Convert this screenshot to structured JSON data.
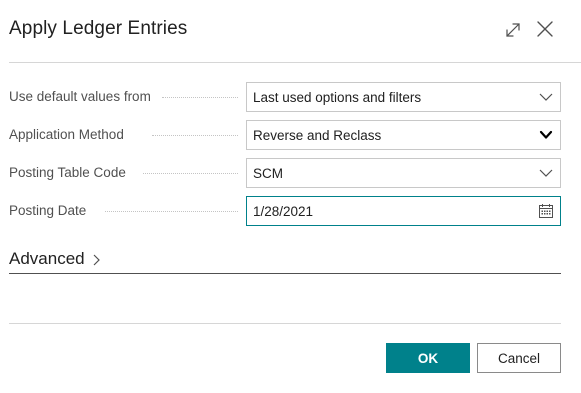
{
  "dialog": {
    "title": "Apply Ledger Entries"
  },
  "fields": [
    {
      "label": "Use default values from",
      "value": "Last used options and filters",
      "control": "dropdown",
      "icon": "chevron-down-icon"
    },
    {
      "label": "Application Method",
      "value": "Reverse and Reclass",
      "control": "select",
      "icon": "select-arrow-icon"
    },
    {
      "label": "Posting Table Code",
      "value": "SCM",
      "control": "dropdown",
      "icon": "chevron-down-icon"
    },
    {
      "label": "Posting Date",
      "value": "1/28/2021",
      "control": "date",
      "icon": "calendar-icon"
    }
  ],
  "advanced": {
    "label": "Advanced"
  },
  "buttons": {
    "ok": "OK",
    "cancel": "Cancel"
  },
  "colors": {
    "accent": "#00818b",
    "text": "#212121",
    "label": "#505050",
    "border": "#c8c8c8"
  }
}
